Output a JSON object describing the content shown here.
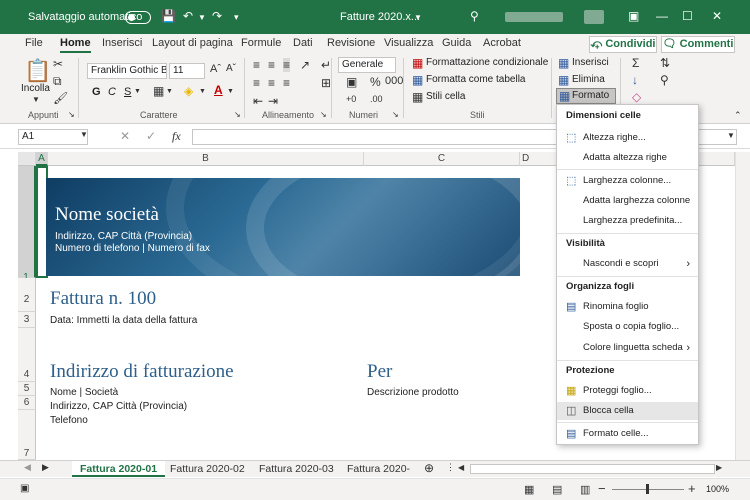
{
  "titlebar": {
    "autosave_label": "Salvataggio automatico",
    "file_title": "Fatture 2020.x...",
    "colors": {
      "bg": "#217346"
    }
  },
  "menu": {
    "file": "File",
    "home": "Home",
    "insert": "Inserisci",
    "layout": "Layout di pagina",
    "formulas": "Formule",
    "data": "Dati",
    "review": "Revisione",
    "view": "Visualizza",
    "help": "Guida",
    "acrobat": "Acrobat",
    "share": "Condividi",
    "comments": "Commenti"
  },
  "ribbon": {
    "paste": "Incolla",
    "clipboard_group": "Appunti",
    "font_name": "Franklin Gothic Boo",
    "font_size": "11",
    "bold": "G",
    "italic": "C",
    "underline": "S",
    "font_group": "Carattere",
    "align_group": "Allineamento",
    "number_format": "Generale",
    "number_group": "Numeri",
    "cond_format": "Formattazione condizionale",
    "format_table": "Formatta come tabella",
    "cell_styles": "Stili cella",
    "styles_group": "Stili",
    "insert_btn": "Inserisci",
    "delete_btn": "Elimina",
    "format_btn": "Formato"
  },
  "formula_bar": {
    "name_box": "A1",
    "fx": "fx"
  },
  "columns": [
    "A",
    "B",
    "C",
    "D"
  ],
  "rows": [
    "1",
    "2",
    "3",
    "4",
    "5",
    "6",
    "7"
  ],
  "sheet": {
    "company_name": "Nome società",
    "company_address": "Indirizzo, CAP Città (Provincia)",
    "company_phone": "Numero di telefono | Numero di fax",
    "invoice_title": "Fattura n. 100",
    "invoice_date": "Data: Immetti la data della fattura",
    "billing_title": "Indirizzo di fatturazione",
    "billing_name": "Nome | Società",
    "billing_address": "Indirizzo, CAP Città (Provincia)",
    "billing_phone": "Telefono",
    "for_title": "Per",
    "for_desc": "Descrizione prodotto"
  },
  "tabs": [
    "Fattura 2020-01",
    "Fattura 2020-02",
    "Fattura 2020-03",
    "Fattura 2020-"
  ],
  "status": {
    "zoom": "100%"
  },
  "dropdown": {
    "section_cell_size": "Dimensioni celle",
    "row_height": "Altezza righe...",
    "autofit_row": "Adatta altezza righe",
    "col_width": "Larghezza colonne...",
    "autofit_col": "Adatta larghezza colonne",
    "default_width": "Larghezza predefinita...",
    "section_visibility": "Visibilità",
    "hide_unhide": "Nascondi e scopri",
    "section_organize": "Organizza fogli",
    "rename_sheet": "Rinomina foglio",
    "move_copy": "Sposta o copia foglio...",
    "tab_color": "Colore linguetta scheda",
    "section_protection": "Protezione",
    "protect_sheet": "Proteggi foglio...",
    "lock_cell": "Blocca cella",
    "format_cells": "Formato celle..."
  }
}
